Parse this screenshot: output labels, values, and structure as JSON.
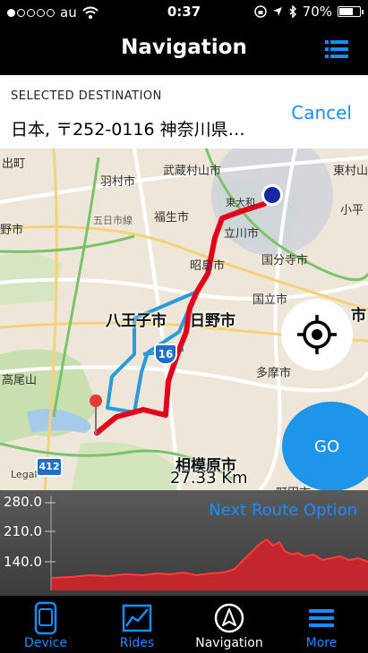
{
  "status_bar": {
    "carrier": "au",
    "time": "0:37",
    "battery": "70%",
    "battery_level": 0.7,
    "icons": [
      "signal-dots-icon",
      "wifi-icon",
      "orientation-lock-icon",
      "location-arrow-icon",
      "bluetooth-icon",
      "battery-icon"
    ]
  },
  "navbar": {
    "title": "Navigation",
    "list_icon": "list-icon"
  },
  "destination": {
    "label": "SELECTED DESTINATION",
    "address": "日本, 〒252-0116 神奈川県…",
    "cancel": "Cancel"
  },
  "map": {
    "labels": {
      "l1": "出町",
      "l2": "羽村市",
      "l3": "武蔵村山市",
      "l4": "東村山",
      "l5": "五日市線",
      "l6": "福生市",
      "l7": "東大和",
      "l8": "小平",
      "l9": "野市",
      "l10": "立川市",
      "l11": "昭島市",
      "l12": "国分寺市",
      "l13": "国立市",
      "l14": "八王子市",
      "l15": "日野市",
      "l16": "市",
      "l17": "高尾山",
      "l18": "多摩市",
      "l19": "相模原市",
      "l20": "町田市",
      "legal": "Legal"
    },
    "route_shields": {
      "r16": "16",
      "r412": "412"
    },
    "distance": "27.33 Km",
    "go_label": "GO",
    "locate_icon": "crosshair-icon"
  },
  "elevation": {
    "ticks": [
      "280.0",
      "210.0",
      "140.0"
    ],
    "next_route": "Next Route Option",
    "colors": {
      "fill": "#c1272d",
      "line": "#ff3b3b"
    }
  },
  "tabbar": {
    "tabs": [
      {
        "label": "Device",
        "icon": "device-icon",
        "active": false
      },
      {
        "label": "Rides",
        "icon": "chart-icon",
        "active": false
      },
      {
        "label": "Navigation",
        "icon": "navigation-arrow-icon",
        "active": true
      },
      {
        "label": "More",
        "icon": "menu-icon",
        "active": false
      }
    ]
  },
  "colors": {
    "accent": "#1a8cff",
    "route": "#e3001b",
    "alt_route": "#2a9ad8",
    "go": "#1e95e8"
  }
}
